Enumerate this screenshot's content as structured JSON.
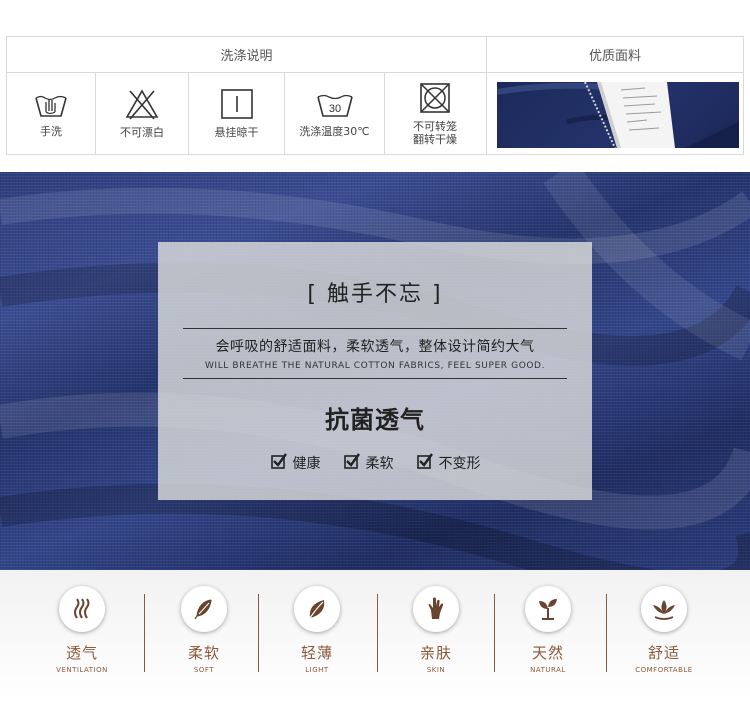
{
  "care": {
    "header_left": "洗涤说明",
    "header_right": "优质面料",
    "items": [
      {
        "icon": "hand-wash-icon",
        "label": "手洗"
      },
      {
        "icon": "no-bleach-icon",
        "label": "不可漂白"
      },
      {
        "icon": "hang-dry-icon",
        "label": "悬挂晾干"
      },
      {
        "icon": "wash-30-icon",
        "label": "洗涤温度30℃",
        "temp": "30"
      },
      {
        "icon": "no-tumble-dry-icon",
        "label_line1": "不可转笼",
        "label_line2": "翻转干燥"
      }
    ]
  },
  "panel": {
    "title": "[ 触手不忘 ]",
    "desc_zh": "会呼吸的舒适面料，柔软透气，整体设计简约大气",
    "desc_en": "WILL BREATHE THE NATURAL COTTON FABRICS, FEEL SUPER GOOD.",
    "headline": "抗菌透气",
    "checks": [
      "健康",
      "柔软",
      "不变形"
    ]
  },
  "features": [
    {
      "icon": "ventilation-icon",
      "zh": "透气",
      "en": "VENTILATION"
    },
    {
      "icon": "feather-icon",
      "zh": "柔软",
      "en": "SOFT"
    },
    {
      "icon": "leaf-icon",
      "zh": "轻薄",
      "en": "LIGHT"
    },
    {
      "icon": "hand-icon",
      "zh": "亲肤",
      "en": "SKIN"
    },
    {
      "icon": "sprout-icon",
      "zh": "天然",
      "en": "NATURAL"
    },
    {
      "icon": "lotus-icon",
      "zh": "舒适",
      "en": "COMFORTABLE"
    }
  ],
  "colors": {
    "accent_brown": "#8a5a3c",
    "fabric_navy": "#2e3f7e"
  }
}
